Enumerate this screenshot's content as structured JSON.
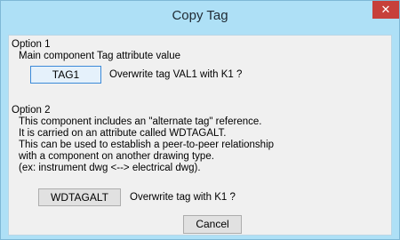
{
  "window": {
    "title": "Copy Tag",
    "close_glyph": "✕"
  },
  "option1": {
    "heading": "Option 1",
    "description": "Main component Tag attribute value",
    "button_label": "TAG1",
    "prompt": "Overwrite tag VAL1 with K1 ?"
  },
  "option2": {
    "heading": "Option 2",
    "lines": [
      "This component includes an \"alternate tag\" reference.",
      "It is carried on an attribute called WDTAGALT.",
      "This can be used to establish a peer-to-peer relationship",
      "with a component on another drawing type.",
      "(ex: instrument dwg <--> electrical dwg)."
    ],
    "button_label": "WDTAGALT",
    "prompt": "Overwrite tag  with K1 ?"
  },
  "cancel_label": "Cancel"
}
